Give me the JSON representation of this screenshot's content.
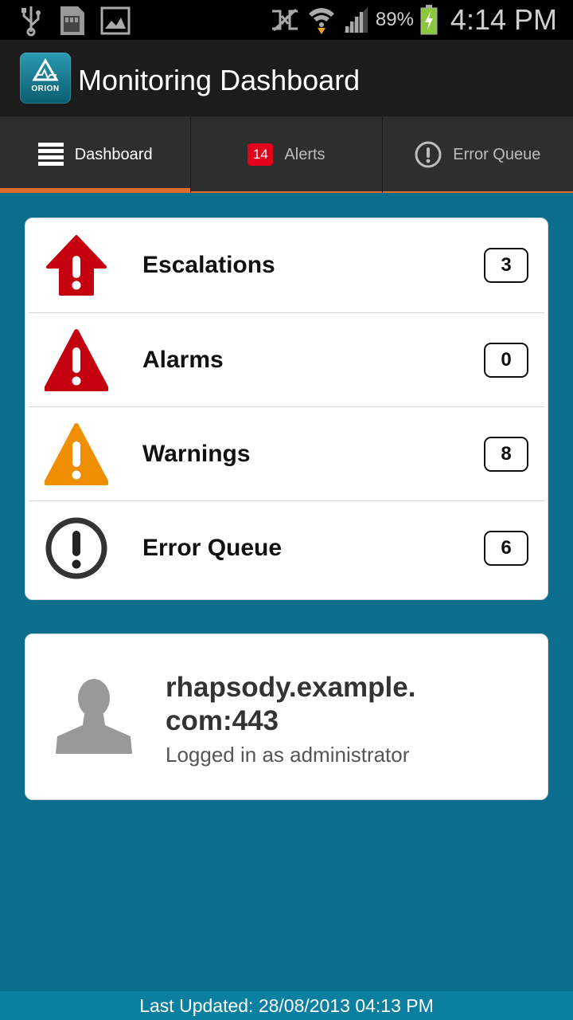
{
  "status_bar": {
    "battery_percent": "89%",
    "time": "4:14 PM",
    "icons": [
      "usb-icon",
      "sd-card-icon",
      "image-icon",
      "nfc-off-icon",
      "wifi-icon",
      "signal-icon",
      "battery-charging-icon"
    ]
  },
  "app": {
    "title": "Monitoring Dashboard",
    "logo_text": "ORION"
  },
  "tabs": [
    {
      "label": "Dashboard",
      "icon": "menu-list-icon",
      "active": true
    },
    {
      "label": "Alerts",
      "badge": "14",
      "active": false
    },
    {
      "label": "Error Queue",
      "icon": "exclamation-circle-icon",
      "active": false
    }
  ],
  "status_items": [
    {
      "label": "Escalations",
      "count": "3",
      "icon": "escalation-arrow-icon",
      "color": "#c4000f"
    },
    {
      "label": "Alarms",
      "count": "0",
      "icon": "alarm-triangle-icon",
      "color": "#c4000f"
    },
    {
      "label": "Warnings",
      "count": "8",
      "icon": "warning-triangle-icon",
      "color": "#ee8e00"
    },
    {
      "label": "Error Queue",
      "count": "6",
      "icon": "error-circle-icon",
      "color": "#333333"
    }
  ],
  "server": {
    "name": "rhapsody.example.\ncom:443",
    "name_line1": "rhapsody.example.",
    "name_line2": "com:443",
    "login": "Logged in as administrator"
  },
  "footer": {
    "last_updated": "Last Updated: 28/08/2013 04:13 PM"
  }
}
